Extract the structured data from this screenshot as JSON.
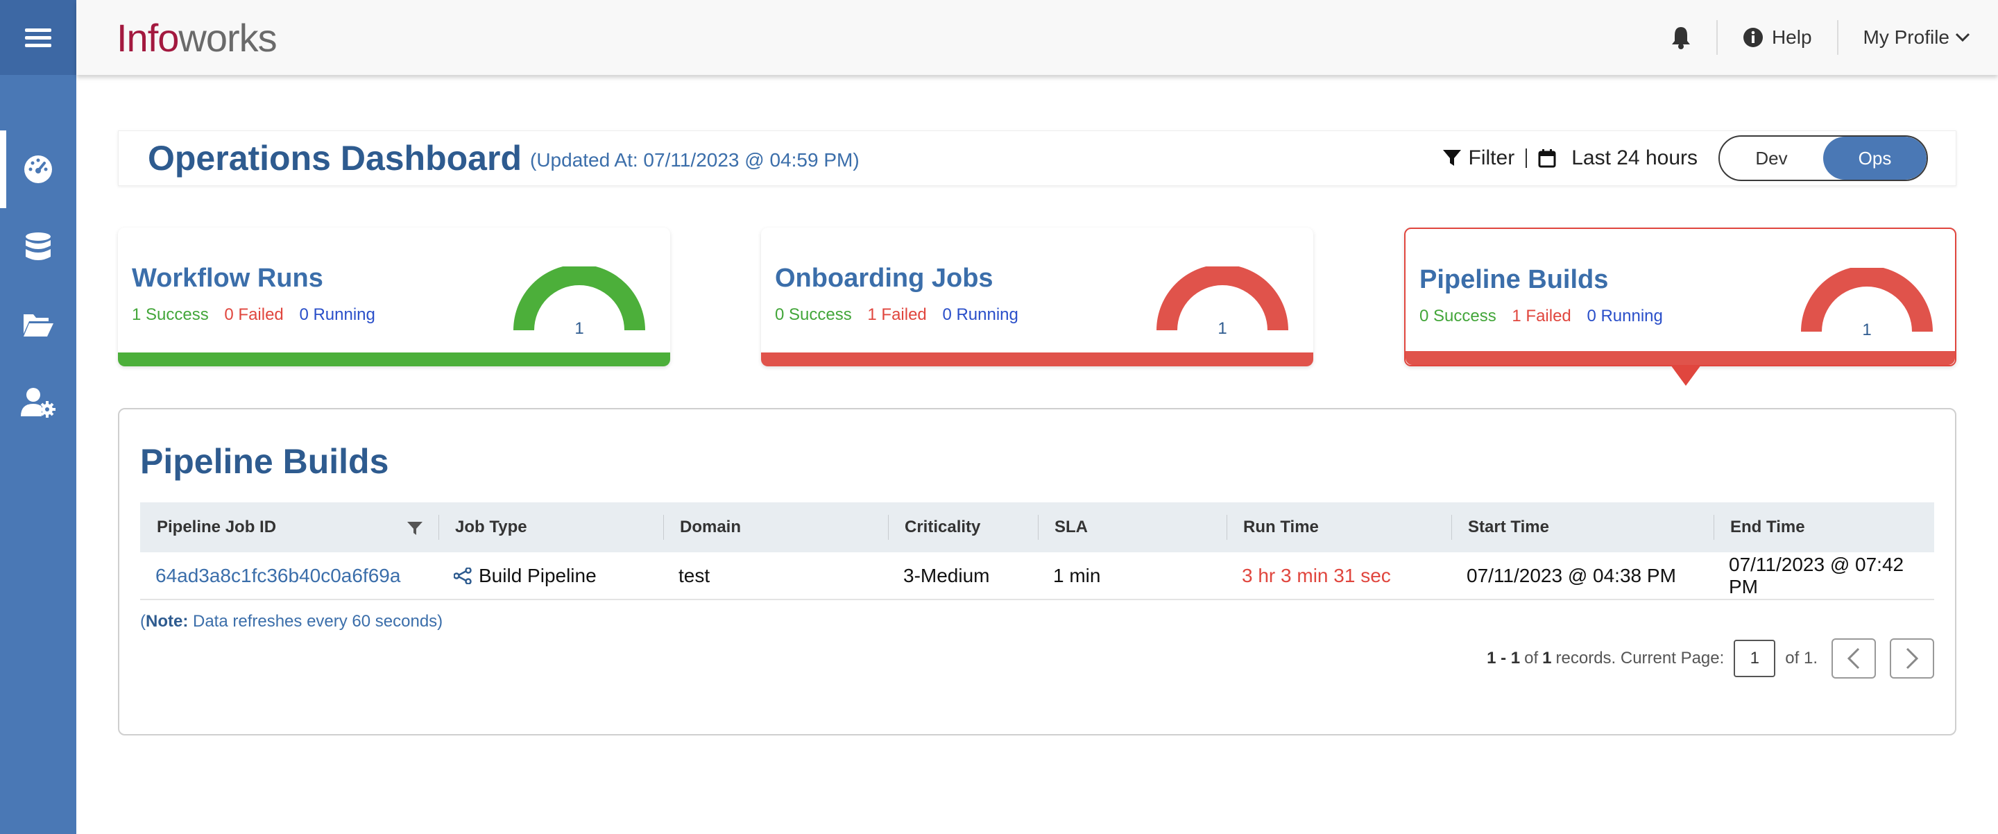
{
  "app": {
    "logo_part1": "Info",
    "logo_part2": "works"
  },
  "header": {
    "help_label": "Help",
    "profile_label": "My Profile"
  },
  "dashboard": {
    "title": "Operations Dashboard",
    "updated": "(Updated At: 07/11/2023 @ 04:59 PM)",
    "filter_label": "Filter",
    "range_label": "Last 24 hours",
    "toggle": {
      "dev": "Dev",
      "ops": "Ops",
      "selected": "Ops"
    }
  },
  "cards": [
    {
      "name": "Workflow Runs",
      "success": "1 Success",
      "failed": "0 Failed",
      "running": "0 Running",
      "count": "1",
      "color": "#4caf3a"
    },
    {
      "name": "Onboarding Jobs",
      "success": "0 Success",
      "failed": "1 Failed",
      "running": "0 Running",
      "count": "1",
      "color": "#e0534b"
    },
    {
      "name": "Pipeline Builds",
      "success": "0 Success",
      "failed": "1 Failed",
      "running": "0 Running",
      "count": "1",
      "color": "#e0534b"
    }
  ],
  "panel": {
    "title": "Pipeline Builds",
    "columns": [
      "Pipeline Job ID",
      "Job Type",
      "Domain",
      "Criticality",
      "SLA",
      "Run Time",
      "Start Time",
      "End Time"
    ],
    "rows": [
      {
        "job_id": "64ad3a8c1fc36b40c0a6f69a",
        "job_type": "Build Pipeline",
        "domain": "test",
        "criticality": "3-Medium",
        "sla": "1 min",
        "run_time": "3 hr 3 min 31 sec",
        "start_time": "07/11/2023 @ 04:38 PM",
        "end_time": "07/11/2023 @ 07:42 PM"
      }
    ],
    "note_label": "Note:",
    "note_text": "Data refreshes every 60 seconds)",
    "note_open": "(",
    "pager": {
      "range": "1 - 1",
      "of_word": "of",
      "total": "1",
      "records_text": "records. Current Page:",
      "current_page": "1",
      "of_pages": "of 1."
    }
  },
  "colors": {
    "sidebar": "#4a78b5",
    "accent": "#2e5b8f",
    "success": "#43a63a",
    "failed": "#e0463e",
    "running": "#2a4fc9"
  }
}
